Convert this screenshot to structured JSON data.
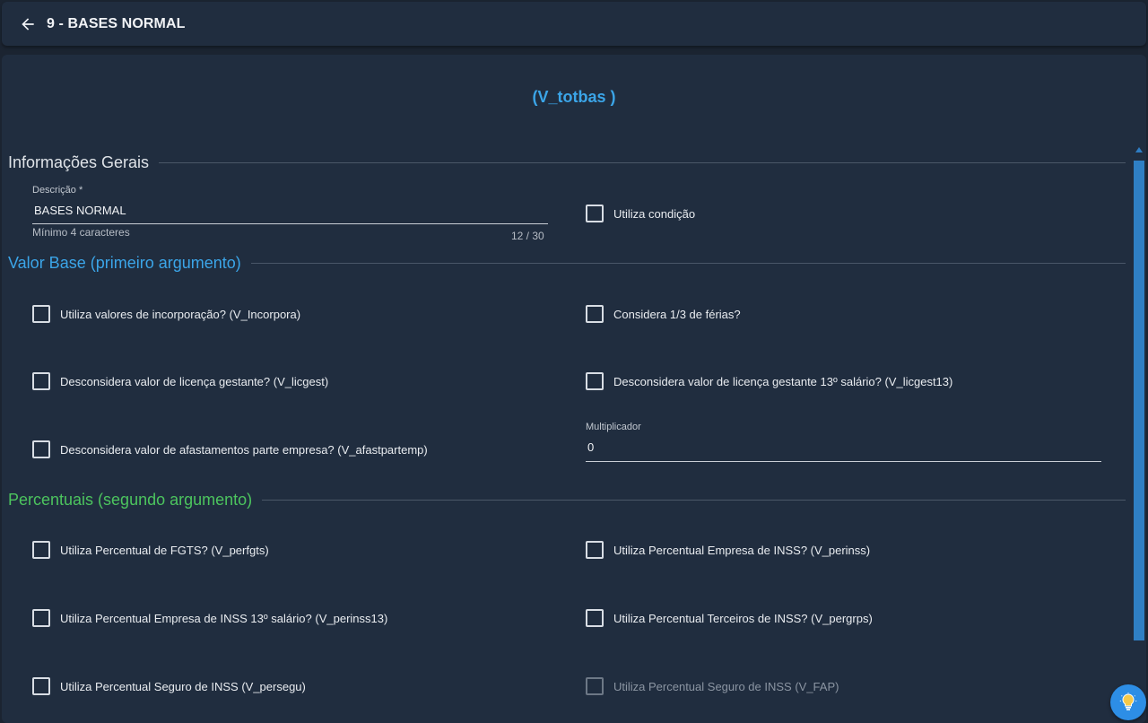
{
  "header": {
    "title": "9 - BASES NORMAL"
  },
  "variable_title": "(V_totbas )",
  "colors": {
    "background": "#1b2431",
    "panel": "#202d3f",
    "accent_blue": "#3ba5e8",
    "accent_green": "#4cc45e"
  },
  "sections": {
    "general": {
      "label": "Informações Gerais",
      "description_field": {
        "label": "Descrição *",
        "value": "BASES NORMAL",
        "hint": "Mínimo 4 caracteres",
        "counter": "12 / 30"
      },
      "use_condition": {
        "label": "Utiliza condição",
        "checked": false
      }
    },
    "base_value": {
      "label": "Valor Base (primeiro argumento)",
      "checks": [
        {
          "label": "Utiliza valores de incorporação? (V_Incorpora)",
          "checked": false
        },
        {
          "label": "Considera 1/3 de férias?",
          "checked": false
        },
        {
          "label": "Desconsidera valor de licença gestante? (V_licgest)",
          "checked": false
        },
        {
          "label": "Desconsidera valor de licença gestante 13º salário? (V_licgest13)",
          "checked": false
        },
        {
          "label": "Desconsidera valor de afastamentos parte empresa? (V_afastpartemp)",
          "checked": false
        }
      ],
      "multiplier": {
        "label": "Multiplicador",
        "value": "0"
      }
    },
    "percentages": {
      "label": "Percentuais (segundo argumento)",
      "checks": [
        {
          "label": "Utiliza Percentual de FGTS? (V_perfgts)",
          "checked": false,
          "disabled": false
        },
        {
          "label": "Utiliza Percentual Empresa de INSS? (V_perinss)",
          "checked": false,
          "disabled": false
        },
        {
          "label": "Utiliza Percentual Empresa de INSS 13º salário? (V_perinss13)",
          "checked": false,
          "disabled": false
        },
        {
          "label": "Utiliza Percentual Terceiros de INSS? (V_pergrps)",
          "checked": false,
          "disabled": false
        },
        {
          "label": "Utiliza Percentual Seguro de INSS (V_persegu)",
          "checked": false,
          "disabled": false
        },
        {
          "label": "Utiliza Percentual Seguro de INSS (V_FAP)",
          "checked": false,
          "disabled": true
        }
      ]
    }
  },
  "icons": {
    "back": "arrow-left-icon",
    "help": "lightbulb-icon"
  }
}
